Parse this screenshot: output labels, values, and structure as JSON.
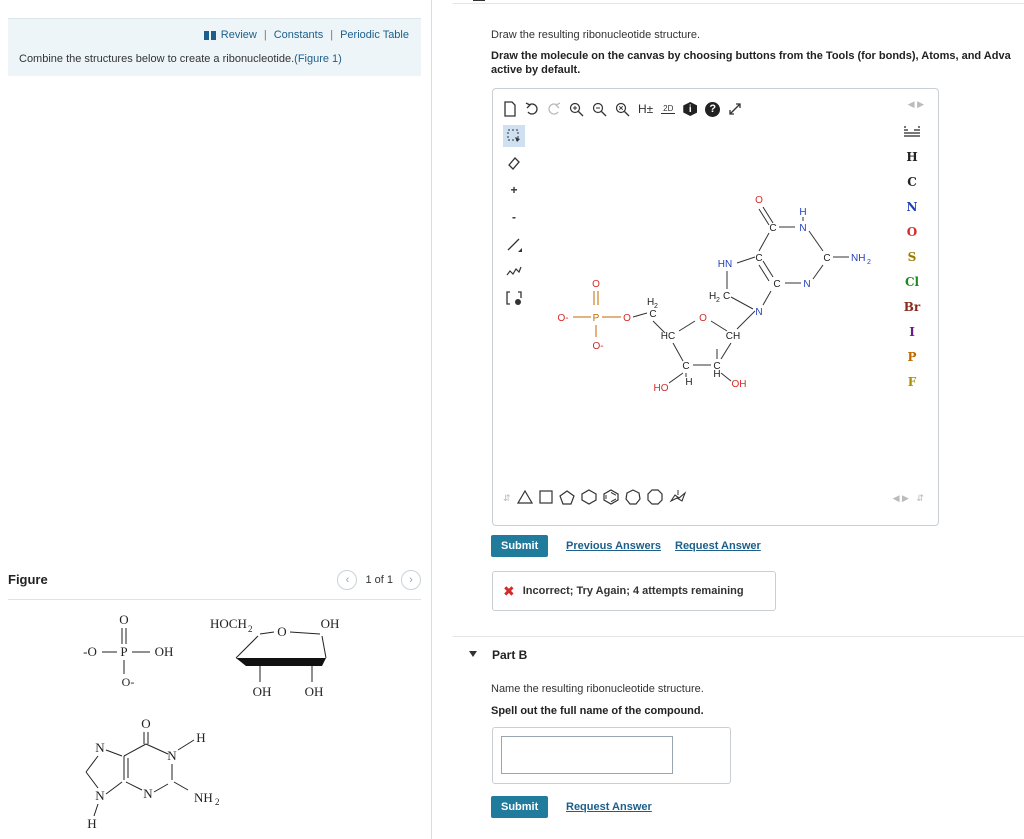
{
  "nav": {
    "review": "Review",
    "constants": "Constants",
    "periodic": "Periodic Table"
  },
  "intro": {
    "text": "Combine the structures below to create a ribonucleotide.",
    "figure_link": "(Figure 1)"
  },
  "figure": {
    "title": "Figure",
    "pager": "1 of 1"
  },
  "figure_molecules": {
    "phosphate": {
      "o_top": "O",
      "left_o": "-O",
      "p": "P",
      "oh": "OH",
      "o_bottom": "O-"
    },
    "ribose": {
      "hoch2": "HOCH",
      "sub2": "2",
      "o": "O",
      "oh_right": "OH",
      "oh_bl": "OH",
      "oh_br": "OH"
    },
    "base": {
      "o": "O",
      "n1": "N",
      "n2": "N",
      "n3": "N",
      "n4": "N",
      "h_right": "H",
      "nh2": "NH",
      "sub2": "2",
      "h_bottom": "H"
    }
  },
  "partA": {
    "q1": "Draw the resulting ribonucleotide structure.",
    "q2": "Draw the molecule on the canvas by choosing buttons from the Tools (for bonds), Atoms, and Adva",
    "q2b": "active by default.",
    "toolbar": {
      "h_toggle": "H±",
      "two_d": "2D",
      "info": "i",
      "help": "?"
    },
    "atoms": [
      "H",
      "C",
      "N",
      "O",
      "S",
      "Cl",
      "Br",
      "I",
      "P",
      "F"
    ],
    "atom_colors": {
      "H": "#222222",
      "C": "#222222",
      "N": "#1f3fbf",
      "O": "#d42a2a",
      "S": "#9a7b00",
      "Cl": "#1c8a1c",
      "Br": "#8a2a1c",
      "I": "#6a1c8a",
      "P": "#c06a00",
      "F": "#a89000"
    },
    "canvas": {
      "o_top": "O",
      "o_minus_left": "O-",
      "p": "P",
      "o_chain": "O",
      "h2": "H",
      "sub2": "2",
      "c_chain": "C",
      "o_bottom": "O-",
      "hc": "HC",
      "o_ring": "O",
      "ch": "CH",
      "c1": "C",
      "c2": "C",
      "h1": "H",
      "h2b": "H",
      "ho": "HO",
      "oh": "OH",
      "hn": "HN",
      "h2c": "H",
      "h2c_sub": "2",
      "h2c_c": "C",
      "n_glyc": "N",
      "o_carbonyl": "O",
      "c_top": "C",
      "n_top": "N",
      "h_top": "H",
      "c_right": "C",
      "nh2": "NH",
      "nh2_sub": "2",
      "c_mid": "C",
      "c_bot": "C",
      "n_bot": "N"
    },
    "submit": "Submit",
    "previous_answers": "Previous Answers",
    "request_answer": "Request Answer",
    "feedback": "Incorrect; Try Again; 4 attempts remaining"
  },
  "partB": {
    "title": "Part B",
    "q1": "Name the resulting ribonucleotide structure.",
    "q2": "Spell out the full name of the compound.",
    "answer_value": "",
    "submit": "Submit",
    "request_answer": "Request Answer"
  }
}
